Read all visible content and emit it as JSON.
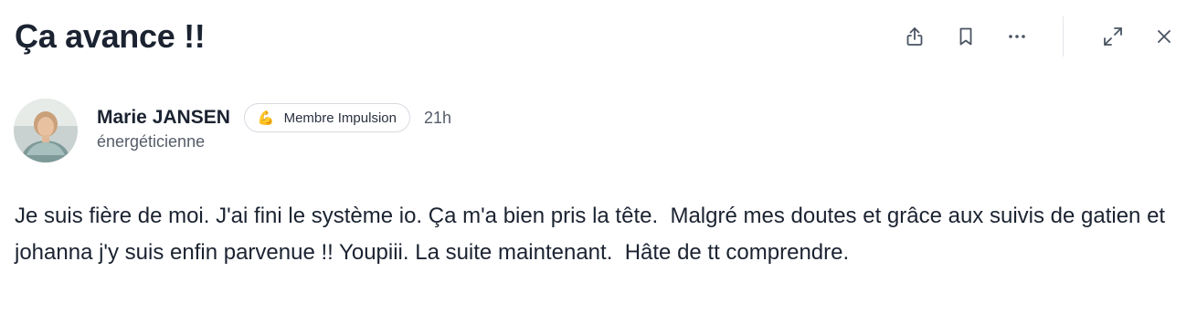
{
  "post": {
    "title": "Ça avance !!",
    "author": {
      "name": "Marie JANSEN",
      "role": "énergéticienne",
      "badge": {
        "emoji": "💪",
        "label": "Membre Impulsion"
      },
      "timestamp": "21h"
    },
    "body": "Je suis fière de moi. J'ai fini le système io. Ça m'a bien pris la tête.  Malgré mes doutes et grâce aux suivis de gatien et johanna j'y suis enfin parvenue !! Youpiii. La suite maintenant.  Hâte de tt comprendre."
  },
  "toolbar": {
    "icons": [
      "share-icon",
      "bookmark-icon",
      "more-icon",
      "expand-icon",
      "close-icon"
    ]
  },
  "colors": {
    "text": "#1b2331",
    "muted": "#555d6a",
    "border": "#d7dbe1",
    "icon": "#4a5362"
  }
}
